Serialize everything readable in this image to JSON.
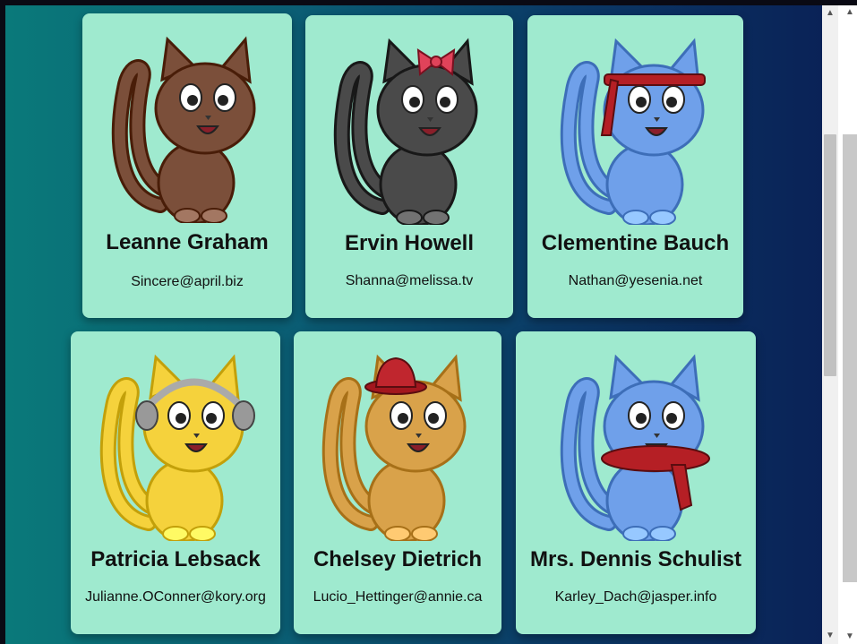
{
  "cards": [
    {
      "name": "Leanne Graham",
      "email": "Sincere@april.biz",
      "fur": "#7b4f3a",
      "accessory": "none"
    },
    {
      "name": "Ervin Howell",
      "email": "Shanna@melissa.tv",
      "fur": "#4a4a4a",
      "accessory": "bow"
    },
    {
      "name": "Clementine Bauch",
      "email": "Nathan@yesenia.net",
      "fur": "#6fa0ea",
      "accessory": "headband"
    },
    {
      "name": "Patricia Lebsack",
      "email": "Julianne.OConner@kory.org",
      "fur": "#f5d23c",
      "accessory": "headphones"
    },
    {
      "name": "Chelsey Dietrich",
      "email": "Lucio_Hettinger@annie.ca",
      "fur": "#d9a24a",
      "accessory": "hat"
    },
    {
      "name": "Mrs. Dennis Schulist",
      "email": "Karley_Dach@jasper.info",
      "fur": "#6fa0ea",
      "accessory": "scarf"
    }
  ],
  "colors": {
    "card_bg": "#9feacf",
    "bg_start": "#0a7a7a",
    "bg_end": "#0a1f55"
  }
}
